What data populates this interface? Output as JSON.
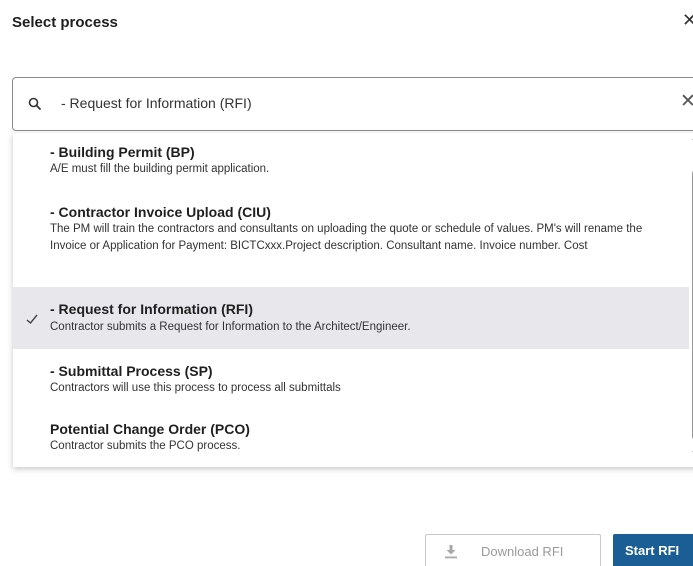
{
  "dialog": {
    "title": "Select process",
    "close_icon": "close-icon"
  },
  "search": {
    "value": "- Request for Information (RFI)",
    "search_icon": "search-icon",
    "clear_icon": "clear-icon"
  },
  "options": [
    {
      "title": "- Building Permit (BP)",
      "description": "A/E must fill the building permit application.",
      "selected": false
    },
    {
      "title": "- Contractor Invoice Upload (CIU)",
      "description": "The PM will train the contractors and consultants on uploading the quote or schedule of values. PM's will rename the Invoice or Application for Payment: BICTCxxx.Project description. Consultant name. Invoice number. Cost",
      "selected": false
    },
    {
      "title": "- Request for Information (RFI)",
      "description": "Contractor submits a Request for Information to the Architect/Engineer.",
      "selected": true
    },
    {
      "title": "- Submittal Process (SP)",
      "description": "Contractors will use this process to process all submittals",
      "selected": false
    },
    {
      "title": "Potential Change Order (PCO)",
      "description": "Contractor submits the PCO process.",
      "selected": false
    }
  ],
  "footer": {
    "download_label": "Download RFI",
    "download_enabled": false,
    "start_label": "Start RFI"
  },
  "colors": {
    "primary": "#1b5e96",
    "selected_row": "#e8e8ec",
    "disabled_text": "#9a9a9a"
  }
}
